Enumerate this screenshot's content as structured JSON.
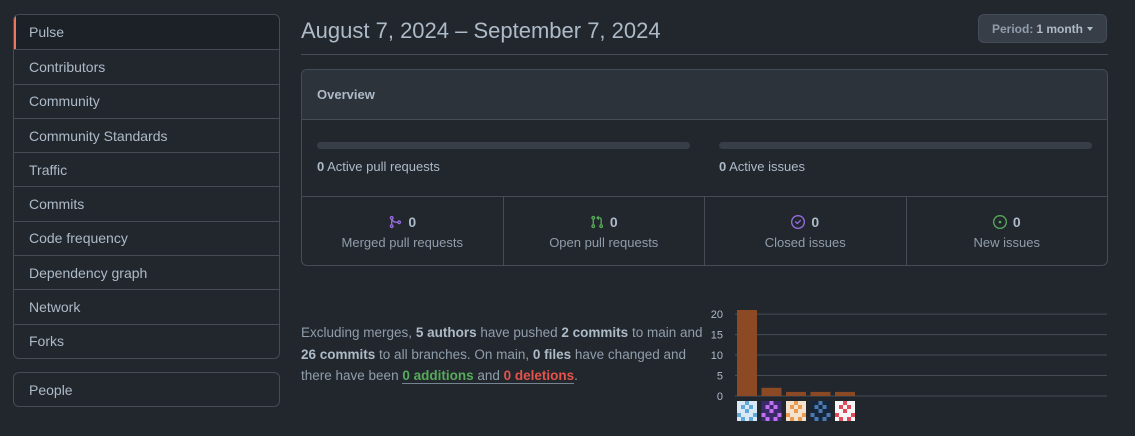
{
  "sidebar": {
    "items": [
      {
        "label": "Pulse",
        "selected": true
      },
      {
        "label": "Contributors"
      },
      {
        "label": "Community"
      },
      {
        "label": "Community Standards"
      },
      {
        "label": "Traffic"
      },
      {
        "label": "Commits"
      },
      {
        "label": "Code frequency"
      },
      {
        "label": "Dependency graph"
      },
      {
        "label": "Network"
      },
      {
        "label": "Forks"
      }
    ],
    "secondary": {
      "label": "People"
    }
  },
  "header": {
    "date_range": "August 7, 2024 – September 7, 2024",
    "period_prefix": "Period:",
    "period_value": "1 month"
  },
  "overview": {
    "title": "Overview",
    "active_prs_count": "0",
    "active_prs_label": "Active pull requests",
    "active_issues_count": "0",
    "active_issues_label": "Active issues",
    "stats": [
      {
        "count": "0",
        "label": "Merged pull requests",
        "icon": "git-merge-icon",
        "color": "#986ee2"
      },
      {
        "count": "0",
        "label": "Open pull requests",
        "icon": "git-pull-request-icon",
        "color": "#57ab5a"
      },
      {
        "count": "0",
        "label": "Closed issues",
        "icon": "issue-closed-icon",
        "color": "#986ee2"
      },
      {
        "count": "0",
        "label": "New issues",
        "icon": "issue-opened-icon",
        "color": "#57ab5a"
      }
    ]
  },
  "summary": {
    "t1": "Excluding merges, ",
    "authors": "5 authors",
    "t2": " have pushed ",
    "commits_main": "2 commits",
    "t3": " to main and ",
    "commits_all": "26 commits",
    "t4": " to all branches. On main, ",
    "files": "0 files",
    "t5": " have changed and there have been ",
    "additions": "0 additions",
    "t6": " and ",
    "deletions": "0 deletions",
    "t7": "."
  },
  "chart_data": {
    "type": "bar",
    "categories": [
      "author-1",
      "author-2",
      "author-3",
      "author-4",
      "author-5"
    ],
    "values": [
      21,
      2,
      1,
      1,
      1
    ],
    "ylim": [
      0,
      21
    ],
    "yticks": [
      "20",
      "15",
      "10",
      "5",
      "0"
    ],
    "bar_color": "#8b4a24",
    "grid": true
  },
  "colors": {
    "accent_selected": "#ec775c",
    "additions": "#57ab5a",
    "deletions": "#e5534b"
  }
}
